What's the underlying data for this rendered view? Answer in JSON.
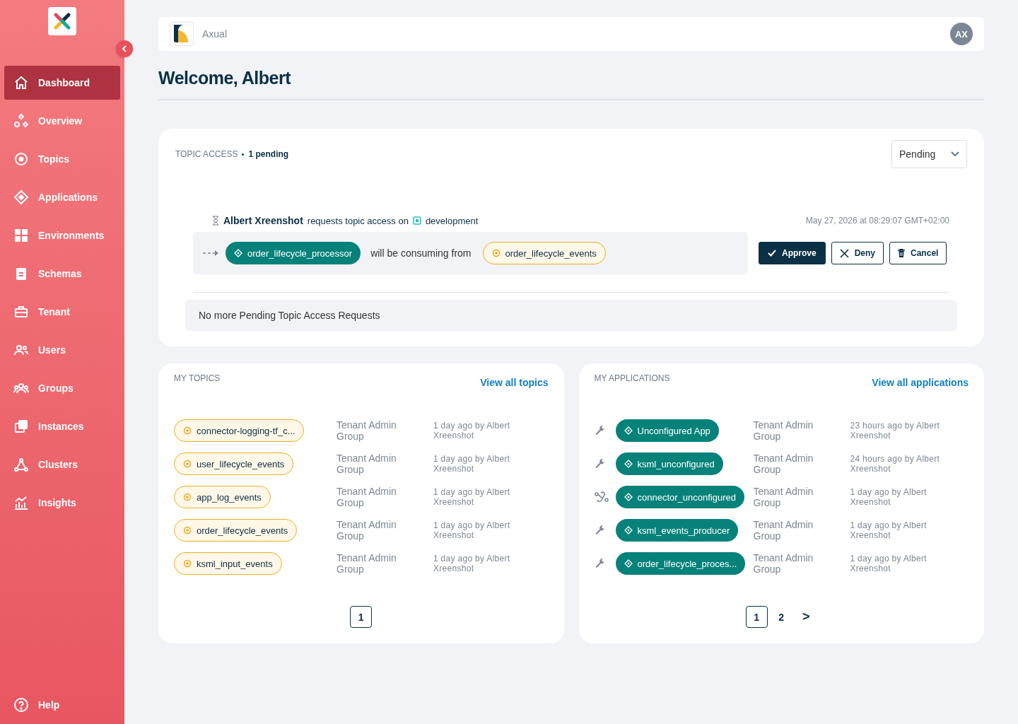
{
  "sidebar": {
    "items": [
      {
        "label": "Dashboard",
        "selected": true
      },
      {
        "label": "Overview",
        "selected": false
      },
      {
        "label": "Topics",
        "selected": false
      },
      {
        "label": "Applications",
        "selected": false
      },
      {
        "label": "Environments",
        "selected": false
      },
      {
        "label": "Schemas",
        "selected": false
      },
      {
        "label": "Tenant",
        "selected": false
      },
      {
        "label": "Users",
        "selected": false
      },
      {
        "label": "Groups",
        "selected": false
      },
      {
        "label": "Instances",
        "selected": false
      },
      {
        "label": "Clusters",
        "selected": false
      },
      {
        "label": "Insights",
        "selected": false
      }
    ],
    "help": "Help"
  },
  "header": {
    "tenant": "Axual",
    "avatar": "AX"
  },
  "title": "Welcome, Albert",
  "topic_access": {
    "heading": "TOPIC ACCESS",
    "count": "1 pending",
    "filter": "Pending",
    "request": {
      "requester": "Albert Xreenshot",
      "action": "requests topic access on",
      "environment": "development",
      "timestamp": "May 27, 2026 at 08:29:07 GMT+02:00",
      "application": "order_lifecycle_processor",
      "relation": "will be consuming from",
      "topic": "order_lifecycle_events"
    },
    "buttons": [
      "Approve",
      "Deny",
      "Cancel"
    ],
    "empty_message": "No more Pending Topic Access Requests"
  },
  "my_topics": {
    "heading": "MY TOPICS",
    "link": "View all topics",
    "rows": [
      {
        "name": "connector-logging-tf_c...",
        "owner": "Tenant Admin Group",
        "modified": "1 day ago by Albert Xreenshot"
      },
      {
        "name": "user_lifecycle_events",
        "owner": "Tenant Admin Group",
        "modified": "1 day ago by Albert Xreenshot"
      },
      {
        "name": "app_log_events",
        "owner": "Tenant Admin Group",
        "modified": "1 day ago by Albert Xreenshot"
      },
      {
        "name": "order_lifecycle_events",
        "owner": "Tenant Admin Group",
        "modified": "1 day ago by Albert Xreenshot"
      },
      {
        "name": "ksml_input_events",
        "owner": "Tenant Admin Group",
        "modified": "1 day ago by Albert Xreenshot"
      }
    ],
    "pages": [
      {
        "label": "1",
        "selected": true
      }
    ]
  },
  "my_applications": {
    "heading": "MY APPLICATIONS",
    "link": "View all applications",
    "rows": [
      {
        "name": "Unconfigured App",
        "owner": "Tenant Admin Group",
        "modified": "23 hours ago by Albert Xreenshot"
      },
      {
        "name": "ksml_unconfigured",
        "owner": "Tenant Admin Group",
        "modified": "24 hours ago by Albert Xreenshot"
      },
      {
        "name": "connector_unconfigured",
        "owner": "Tenant Admin Group",
        "modified": "1 day ago by Albert Xreenshot"
      },
      {
        "name": "ksml_events_producer",
        "owner": "Tenant Admin Group",
        "modified": "1 day ago by Albert Xreenshot"
      },
      {
        "name": "order_lifecycle_proces...",
        "owner": "Tenant Admin Group",
        "modified": "1 day ago by Albert Xreenshot"
      }
    ],
    "pages": [
      {
        "label": "1",
        "selected": true
      },
      {
        "label": "2",
        "selected": false
      }
    ],
    "next": ">"
  }
}
